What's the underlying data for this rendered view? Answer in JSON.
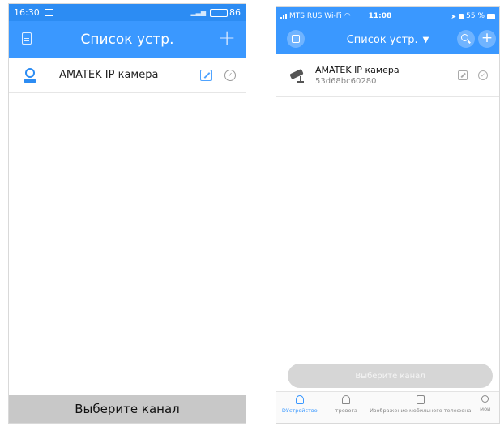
{
  "android": {
    "status": {
      "time": "16:30",
      "battery": "86",
      "battery_pct": 86
    },
    "nav": {
      "title": "Список устр.",
      "add_icon": "plus-icon"
    },
    "devices": [
      {
        "name": "AMATEK IP камера"
      }
    ],
    "bottom_button": "Выберите канал"
  },
  "ios": {
    "status": {
      "carrier": "MTS RUS Wi-Fi",
      "time": "11:08",
      "battery": "55 %"
    },
    "nav": {
      "title": "Список устр.",
      "caret": "▼",
      "add": "+"
    },
    "devices": [
      {
        "name": "AMATEK IP камера",
        "serial": "53d68bc60280"
      }
    ],
    "select_button": "Выберите канал",
    "tabs": [
      {
        "label": "DУстройство",
        "icon": "device-icon",
        "active": true
      },
      {
        "label": "тревога",
        "icon": "bell-icon",
        "active": false
      },
      {
        "label": "Изображение мобильного телефона",
        "icon": "phone-image-icon",
        "active": false
      },
      {
        "label": "мой",
        "icon": "user-icon",
        "active": false
      }
    ]
  },
  "colors": {
    "primary": "#3a98ff",
    "status_android": "#2c8cf3",
    "bottom_bar": "#c8c8c8"
  }
}
